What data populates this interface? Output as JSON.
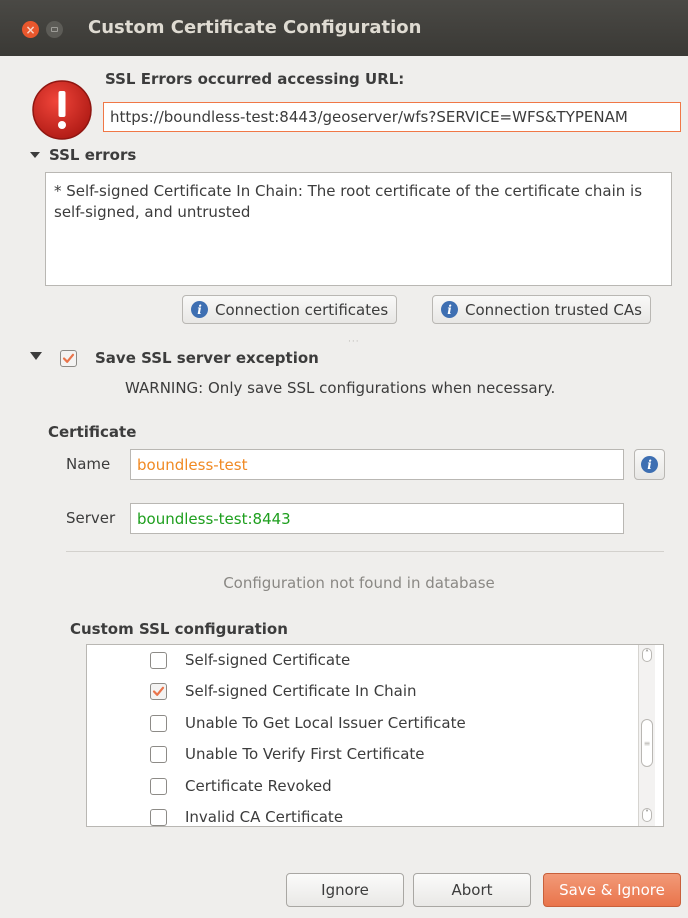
{
  "window": {
    "title": "Custom Certificate Configuration"
  },
  "header": {
    "errors_label": "SSL Errors occurred accessing URL:",
    "url": "https://boundless-test:8443/geoserver/wfs?SERVICE=WFS&TYPENAM"
  },
  "ssl_errors": {
    "title": "SSL errors",
    "text": "* Self-signed Certificate In Chain: The root certificate of the certificate chain is self-signed, and untrusted",
    "buttons": [
      "Connection certificates",
      "Connection trusted CAs"
    ]
  },
  "exception": {
    "title": "Save SSL server exception",
    "checked": true,
    "warning": "WARNING: Only save SSL configurations when necessary."
  },
  "certificate": {
    "title": "Certificate",
    "name_label": "Name",
    "name_value": "boundless-test",
    "server_label": "Server",
    "server_value": "boundless-test:8443",
    "status": "Configuration not found in database"
  },
  "custom_ssl": {
    "title": "Custom SSL configuration",
    "items": [
      {
        "label": "Self-signed Certificate",
        "checked": false
      },
      {
        "label": "Self-signed Certificate In Chain",
        "checked": true
      },
      {
        "label": "Unable To Get Local Issuer Certificate",
        "checked": false
      },
      {
        "label": "Unable To Verify First Certificate",
        "checked": false
      },
      {
        "label": "Certificate Revoked",
        "checked": false
      },
      {
        "label": "Invalid CA Certificate",
        "checked": false
      }
    ]
  },
  "footer": {
    "ignore_label": "Ignore",
    "abort_label": "Abort",
    "save_ignore_label": "Save & Ignore"
  },
  "colors": {
    "accent": "#e9744b",
    "name_text": "#f08a24",
    "server_text": "#1e9f1e",
    "url_border": "#f07746"
  }
}
